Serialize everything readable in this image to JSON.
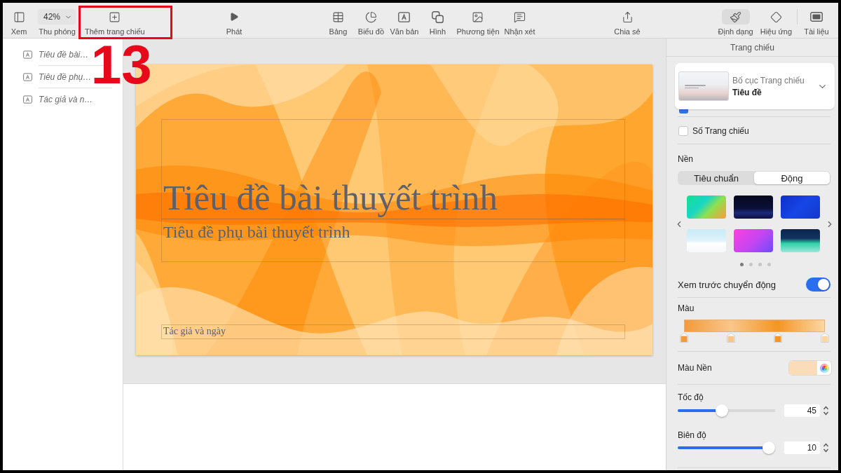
{
  "toolbar": {
    "groups": [
      [
        {
          "kind": "button",
          "label": "Xem"
        },
        {
          "kind": "zoom",
          "value": "42%",
          "label": "Thu phóng"
        },
        {
          "kind": "button",
          "label": "Thêm trang chiếu",
          "highlighted": true,
          "callout": "13"
        }
      ],
      [
        {
          "kind": "button",
          "label": "Phát"
        }
      ],
      [
        {
          "kind": "button",
          "label": "Bảng"
        },
        {
          "kind": "button",
          "label": "Biểu đồ"
        },
        {
          "kind": "button",
          "label": "Văn bản"
        },
        {
          "kind": "button",
          "label": "Hình"
        },
        {
          "kind": "button",
          "label": "Phương tiện"
        },
        {
          "kind": "button",
          "label": "Nhận xét"
        }
      ],
      [
        {
          "kind": "button",
          "label": "Chia sẻ"
        }
      ],
      [
        {
          "kind": "button",
          "label": "Định dạng",
          "selected": true
        },
        {
          "kind": "button",
          "label": "Hiệu ứng",
          "selected": false
        },
        {
          "kind": "button",
          "label": "Tài liệu",
          "selected": false
        }
      ]
    ]
  },
  "sidebar": {
    "items": [
      {
        "label": "Tiêu đề bài…"
      },
      {
        "label": "Tiêu đề phụ…"
      },
      {
        "label": "Tác giả và n…"
      }
    ]
  },
  "slide": {
    "title": "Tiêu đề bài thuyết trình",
    "subtitle": "Tiêu đề phụ bài thuyết trình",
    "footer": "Tác giả và ngày"
  },
  "inspector": {
    "title": "Trang chiếu",
    "layout": {
      "caption": "Bố cục Trang chiếu",
      "name": "Tiêu đề"
    },
    "covered_checkbox": {
      "checked": true
    },
    "checkboxes": [
      {
        "label": "Số Trang chiếu",
        "checked": false
      }
    ],
    "background": {
      "heading": "Nền",
      "segments": [
        {
          "label": "Tiêu chuẩn",
          "selected": false
        },
        {
          "label": "Động",
          "selected": true
        }
      ],
      "page_dots": [
        {
          "selected": true
        },
        {
          "selected": false
        },
        {
          "selected": false
        },
        {
          "selected": false
        }
      ]
    },
    "motion_preview": {
      "label": "Xem trước chuyển động",
      "on": true
    },
    "colors": {
      "heading": "Màu",
      "stops": [
        {
          "color": "#f39a3c"
        },
        {
          "color": "#f9c68a"
        },
        {
          "color": "#f49524"
        },
        {
          "color": "#fbd7a3"
        }
      ]
    },
    "background_color": {
      "label": "Màu Nền",
      "color": "#fbdcb8"
    },
    "sliders": [
      {
        "label": "Tốc độ",
        "level": 0.45,
        "value": "45"
      },
      {
        "label": "Biên độ",
        "level": 0.94,
        "value": "10"
      }
    ]
  }
}
